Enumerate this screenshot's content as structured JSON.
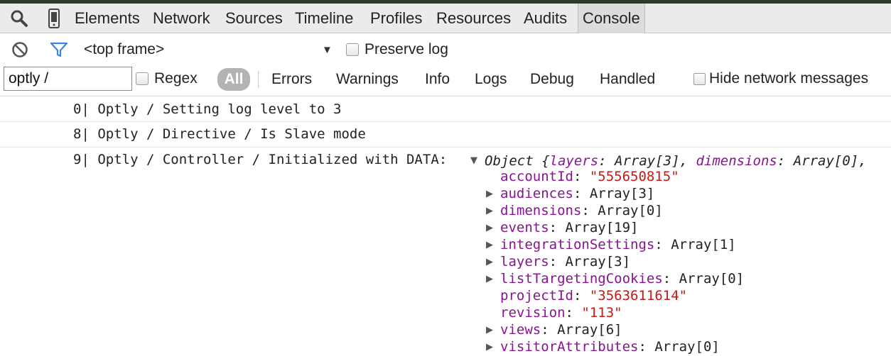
{
  "tabs": [
    "Elements",
    "Network",
    "Sources",
    "Timeline",
    "Profiles",
    "Resources",
    "Audits",
    "Console"
  ],
  "toolbar": {
    "frame": "<top frame>",
    "preserve_log": "Preserve log"
  },
  "filter": {
    "value": "optly /",
    "regex": "Regex",
    "levels": [
      "All",
      "Errors",
      "Warnings",
      "Info",
      "Logs",
      "Debug",
      "Handled"
    ],
    "hide_network": "Hide network messages"
  },
  "console": {
    "messages": [
      {
        "text": "0| Optly / Setting log level to 3"
      },
      {
        "text": "8| Optly / Directive / Is Slave mode"
      },
      {
        "text": "9| Optly / Controller / Initialized with DATA:"
      }
    ],
    "object_summary": {
      "prefix": "Object {",
      "k1": "layers",
      "v1": ": Array[3], ",
      "k2": "dimensions",
      "v2": ": Array[0],"
    },
    "properties": [
      {
        "key": "accountId",
        "value": "\"555650815\"",
        "type": "string"
      },
      {
        "key": "audiences",
        "value": "Array[3]",
        "type": "array"
      },
      {
        "key": "dimensions",
        "value": "Array[0]",
        "type": "array"
      },
      {
        "key": "events",
        "value": "Array[19]",
        "type": "array"
      },
      {
        "key": "integrationSettings",
        "value": "Array[1]",
        "type": "array"
      },
      {
        "key": "layers",
        "value": "Array[3]",
        "type": "array"
      },
      {
        "key": "listTargetingCookies",
        "value": "Array[0]",
        "type": "array"
      },
      {
        "key": "projectId",
        "value": "\"3563611614\"",
        "type": "string"
      },
      {
        "key": "revision",
        "value": "\"113\"",
        "type": "string"
      },
      {
        "key": "views",
        "value": "Array[6]",
        "type": "array"
      },
      {
        "key": "visitorAttributes",
        "value": "Array[0]",
        "type": "array"
      }
    ]
  }
}
